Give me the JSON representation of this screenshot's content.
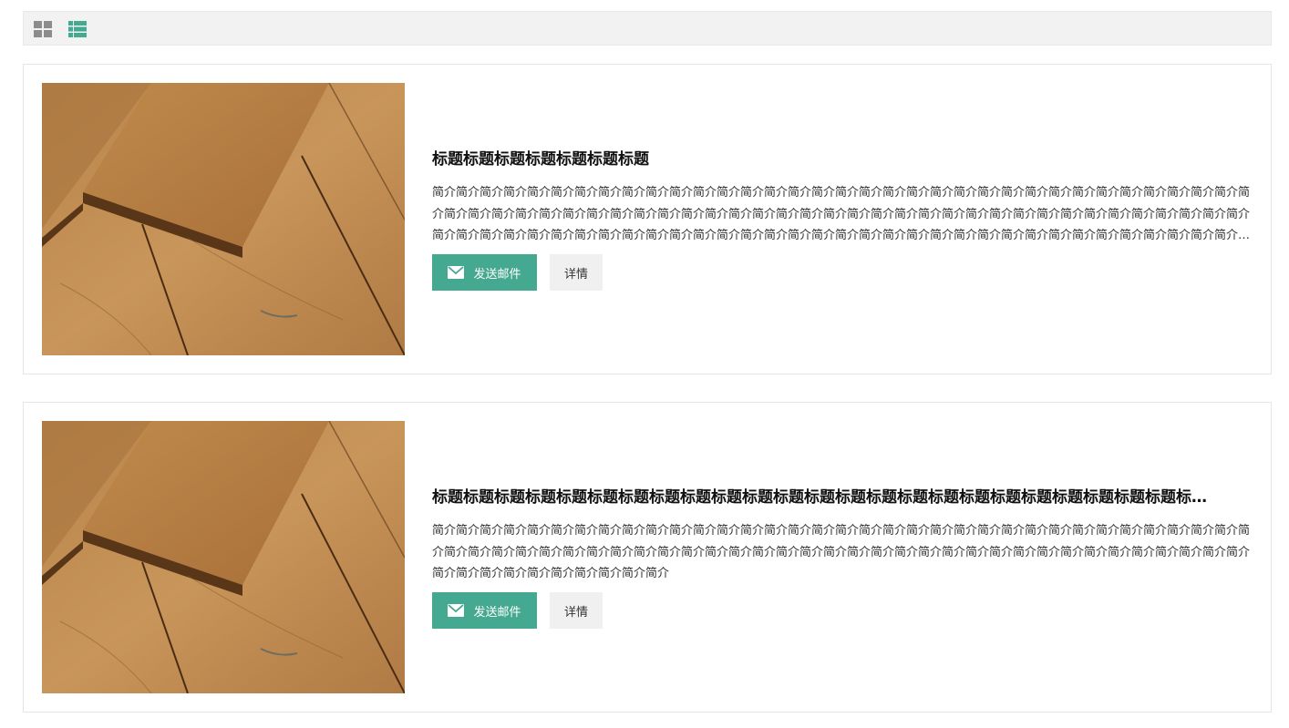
{
  "toolbar": {
    "icons": [
      "grid-view-icon",
      "list-view-icon"
    ],
    "active_color": "#45a890",
    "inactive_color": "#8c8c8c"
  },
  "items": [
    {
      "title": "标题标题标题标题标题标题标题",
      "description": "简介简介简介简介简介简介简介简介简介简介简介简介简介简介简介简介简介简介简介简介简介简介简介简介简介简介简介简介简介简介简介简介简介简介简介简介简介简介简介简介简介简介简介简介简介简介简介简介简介简介简介简介简介简介简介简介简介简介简介简介简介简介简介简介简介简介简介简介简介简介简介简介简介简介简介简介简介简介简介简介简介简介简介简介简介简介简介简介简介简介简介简介简介简介简介简介简介简介简介简介简介简介简介简介…",
      "mail_label": "发送邮件",
      "detail_label": "详情"
    },
    {
      "title": "标题标题标题标题标题标题标题标题标题标题标题标题标题标题标题标题标题标题标题标题标题标题标题标题标…",
      "description": "简介简介简介简介简介简介简介简介简介简介简介简介简介简介简介简介简介简介简介简介简介简介简介简介简介简介简介简介简介简介简介简介简介简介简介简介简介简介简介简介简介简介简介简介简介简介简介简介简介简介简介简介简介简介简介简介简介简介简介简介简介简介简介简介简介简介简介简介简介简介简介简介简介简介简介简介简介简介简介",
      "mail_label": "发送邮件",
      "detail_label": "详情"
    }
  ],
  "colors": {
    "primary": "#45a890",
    "detail_bg": "#f0f0f0",
    "toolbar_bg": "#f2f2f2"
  }
}
